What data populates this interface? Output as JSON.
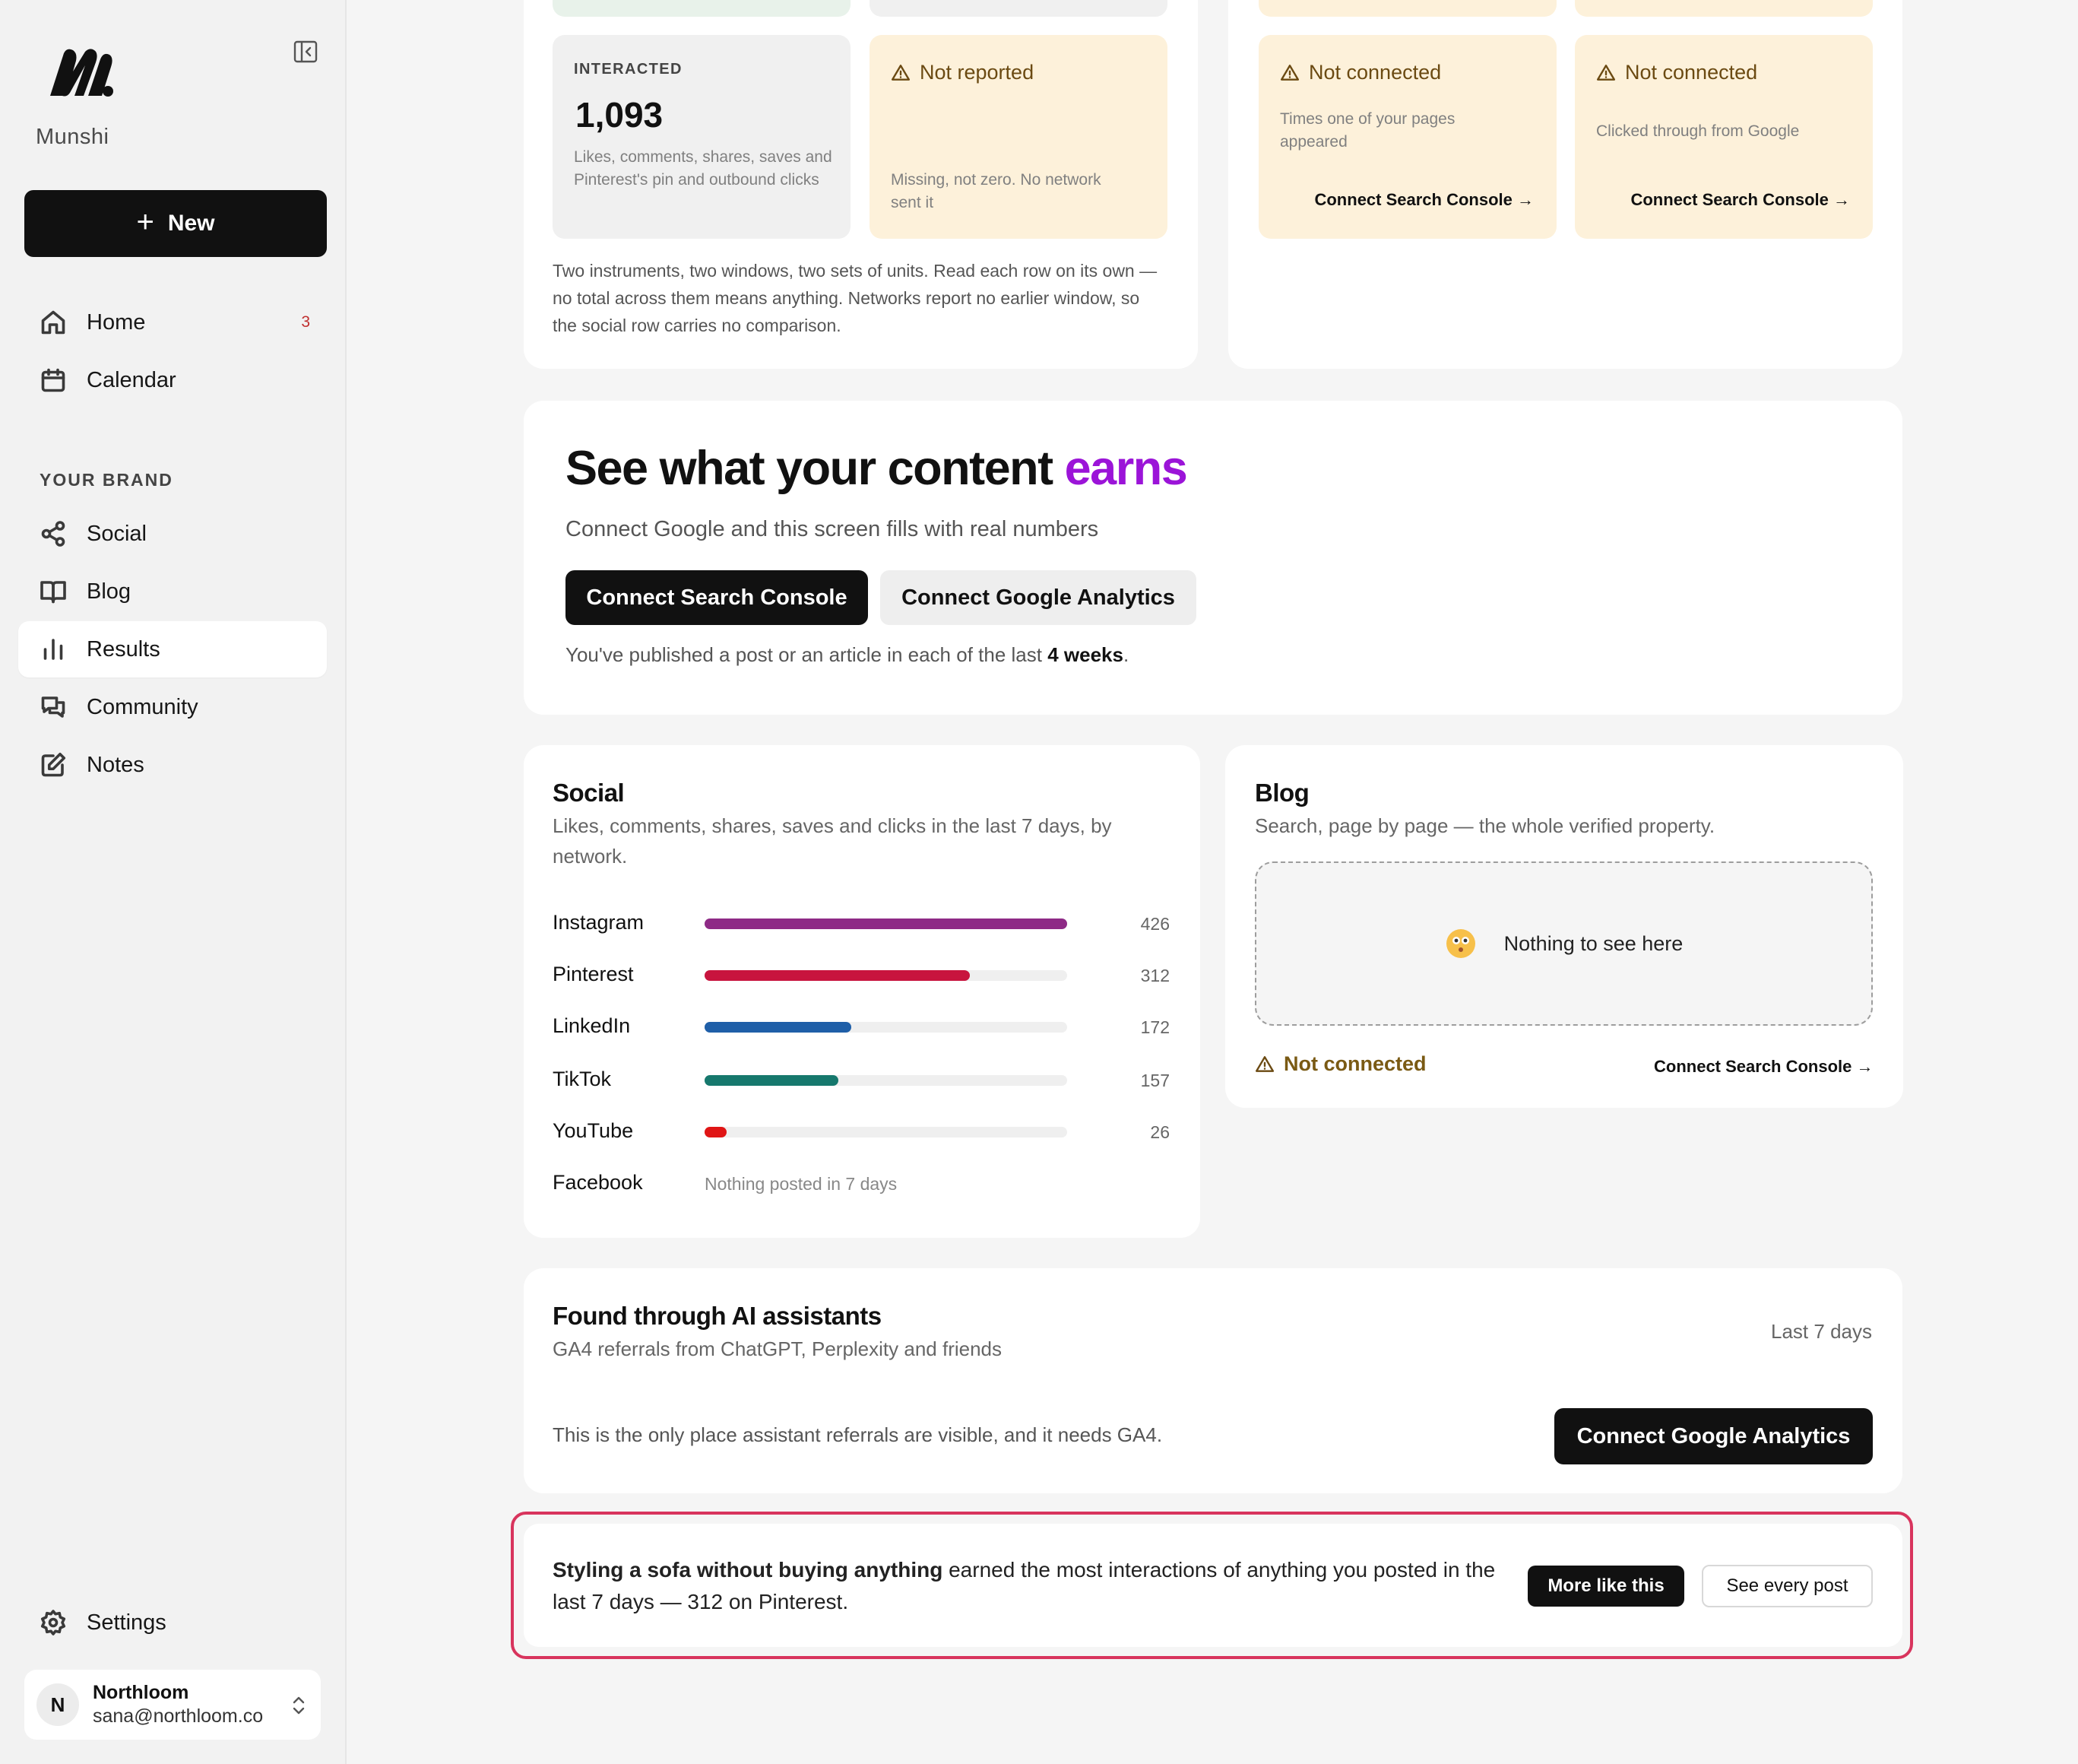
{
  "sidebar": {
    "brand": "Munshi",
    "new_label": "New",
    "nav": [
      {
        "label": "Home",
        "badge": "3"
      },
      {
        "label": "Calendar"
      }
    ],
    "section_label": "YOUR BRAND",
    "brand_nav": [
      {
        "label": "Social"
      },
      {
        "label": "Blog"
      },
      {
        "label": "Results"
      },
      {
        "label": "Community"
      },
      {
        "label": "Notes"
      }
    ],
    "settings_label": "Settings",
    "account": {
      "initial": "N",
      "name": "Northloom",
      "email": "sana@northloom.co"
    }
  },
  "top_left": {
    "interacted": {
      "label": "INTERACTED",
      "value": "1,093",
      "desc": "Likes, comments, shares, saves and Pinterest's pin and outbound clicks"
    },
    "not_reported": {
      "title": "Not reported",
      "desc": "Missing, not zero. No network sent it"
    },
    "note": "Two instruments, two windows, two sets of units. Read each row on its own — no total across them means anything. Networks report no earlier window, so the social row carries no comparison."
  },
  "top_right": {
    "tile1": {
      "title": "Not connected",
      "desc": "Times one of your pages appeared",
      "link": "Connect Search Console →"
    },
    "tile2": {
      "title": "Not connected",
      "desc": "Clicked through from Google",
      "link": "Connect Search Console →"
    }
  },
  "hero": {
    "title_main": "See what your content",
    "title_accent": "earns",
    "subtitle": "Connect Google and this screen fills with real numbers",
    "btn_search_console": "Connect Search Console",
    "btn_analytics": "Connect Google Analytics",
    "streak_prefix": "You've published a post or an article in each of the last",
    "streak_bold": "4 weeks",
    "streak_suffix": "."
  },
  "social": {
    "title": "Social",
    "subtitle": "Likes, comments, shares, saves and clicks in the last 7 days, by network.",
    "networks": [
      {
        "name": "Instagram",
        "value": 426,
        "color": "#8e2a86"
      },
      {
        "name": "Pinterest",
        "value": 312,
        "color": "#c8143e"
      },
      {
        "name": "LinkedIn",
        "value": 172,
        "color": "#1f5fa8"
      },
      {
        "name": "TikTok",
        "value": 157,
        "color": "#16786d"
      },
      {
        "name": "YouTube",
        "value": 26,
        "color": "#e01515"
      },
      {
        "name": "Facebook",
        "empty": "Nothing posted in 7 days"
      }
    ],
    "max": 426
  },
  "blog": {
    "title": "Blog",
    "subtitle": "Search, page by page — the whole verified property.",
    "empty_text": "Nothing to see here",
    "status": "Not connected",
    "link": "Connect Search Console →"
  },
  "ai": {
    "title": "Found through AI assistants",
    "subtitle": "GA4 referrals from ChatGPT, Perplexity and friends",
    "period": "Last 7 days",
    "body": "This is the only place assistant referrals are visible, and it needs GA4.",
    "button": "Connect Google Analytics"
  },
  "highlight": {
    "post_title": "Styling a sofa without buying anything",
    "text": " earned the most interactions of anything you posted in the last 7 days — 312 on Pinterest.",
    "btn_more": "More like this",
    "btn_all": "See every post"
  }
}
